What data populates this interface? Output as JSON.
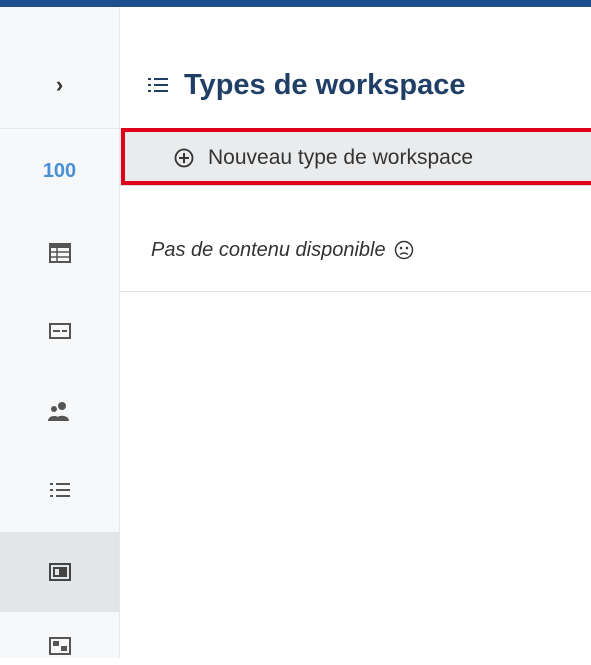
{
  "sidebar": {
    "toggle_icon": "chevron-right-icon",
    "count": "100",
    "items": [
      {
        "icon": "table-icon"
      },
      {
        "icon": "card-icon"
      },
      {
        "icon": "users-icon"
      },
      {
        "icon": "list-icon"
      },
      {
        "icon": "workspace-type-icon",
        "active": true
      },
      {
        "icon": "dashboard-icon"
      }
    ]
  },
  "header": {
    "icon": "list-icon",
    "title": "Types de workspace"
  },
  "actions": {
    "new_label": "Nouveau type de workspace",
    "new_icon": "plus-circle-icon"
  },
  "content": {
    "empty_text": "Pas de contenu disponible",
    "empty_icon": "sad-face-icon"
  },
  "colors": {
    "accent": "#1f4e8c",
    "count": "#4a90d9",
    "title": "#1f3f66",
    "highlight": "#e3001b"
  }
}
